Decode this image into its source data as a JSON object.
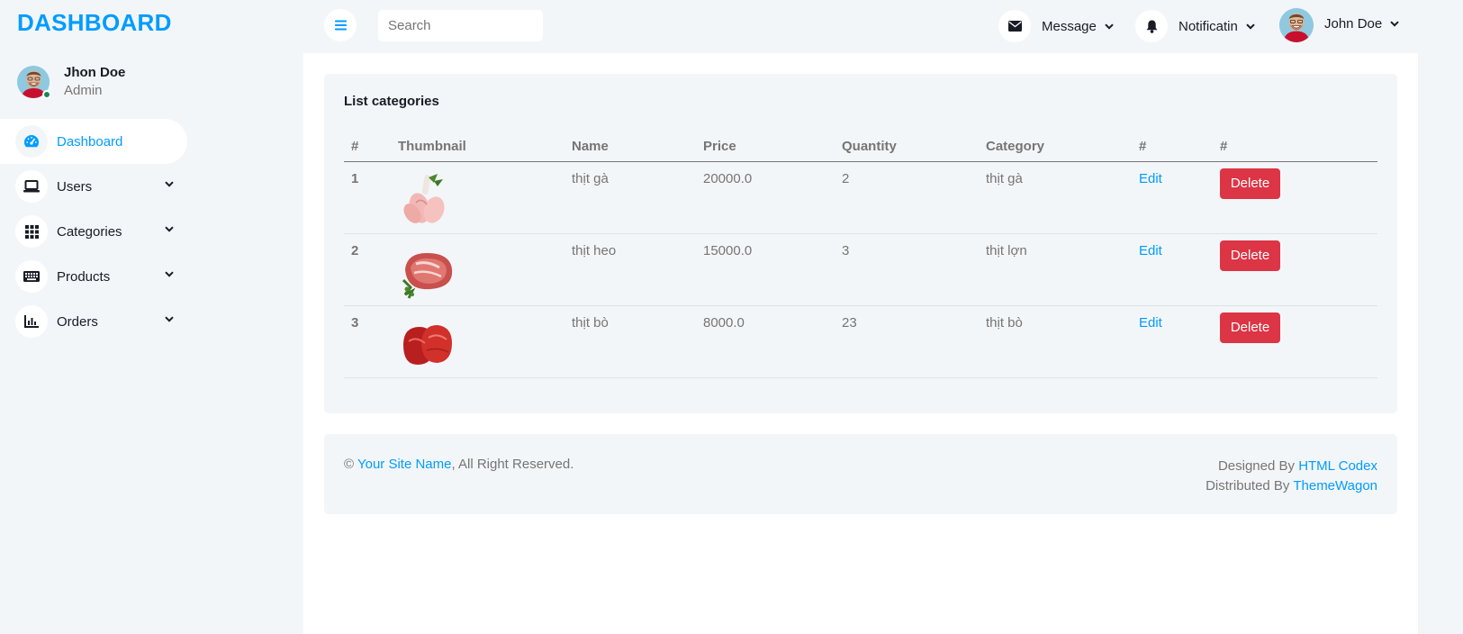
{
  "brand": "DASHBOARD",
  "profile": {
    "name": "Jhon Doe",
    "role": "Admin"
  },
  "nav": {
    "items": [
      {
        "label": "Dashboard",
        "icon": "tachometer-icon",
        "active": true
      },
      {
        "label": "Users",
        "icon": "laptop-icon"
      },
      {
        "label": "Categories",
        "icon": "grid-icon"
      },
      {
        "label": "Products",
        "icon": "keyboard-icon"
      },
      {
        "label": "Orders",
        "icon": "chart-bar-icon"
      }
    ]
  },
  "topbar": {
    "search_placeholder": "Search",
    "message_label": "Message",
    "notification_label": "Notificatin",
    "user_label": "John Doe"
  },
  "card": {
    "title": "List categories",
    "columns": [
      "#",
      "Thumbnail",
      "Name",
      "Price",
      "Quantity",
      "Category",
      "#",
      "#"
    ],
    "rows": [
      {
        "index": "1",
        "thumbnail": "chicken-meat-image",
        "name": "thịt gà",
        "price": "20000.0",
        "quantity": "2",
        "category": "thịt gà",
        "edit": "Edit",
        "delete": "Delete"
      },
      {
        "index": "2",
        "thumbnail": "pork-meat-image",
        "name": "thịt heo",
        "price": "15000.0",
        "quantity": "3",
        "category": "thịt lợn",
        "edit": "Edit",
        "delete": "Delete"
      },
      {
        "index": "3",
        "thumbnail": "beef-meat-image",
        "name": "thịt bò",
        "price": "8000.0",
        "quantity": "23",
        "category": "thịt bò",
        "edit": "Edit",
        "delete": "Delete"
      }
    ]
  },
  "footer": {
    "copyright_symbol": "©",
    "site_name": "Your Site Name",
    "rights": ", All Right Reserved.",
    "designed_by_label": "Designed By",
    "designed_by_link": "HTML Codex",
    "distributed_by_label": "Distributed By",
    "distributed_by_link": "ThemeWagon"
  },
  "colors": {
    "primary": "#009CFF",
    "danger": "#DC3545",
    "background": "#F3F6F9",
    "dark": "#191C24",
    "muted": "#757575"
  }
}
